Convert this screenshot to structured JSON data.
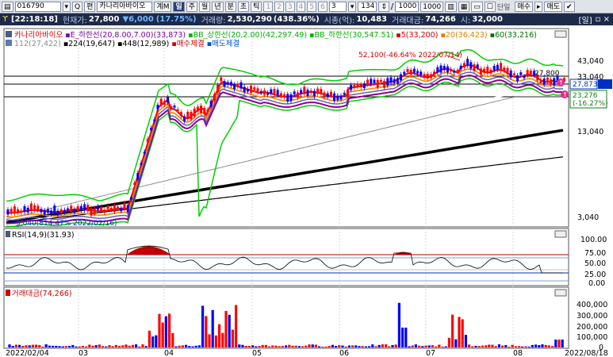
{
  "toolbar": {
    "code": "016790",
    "search_btn": "Q",
    "search_btn2": "편",
    "name": "카나리아바이오",
    "gm_btn": "계M",
    "periods": [
      "일",
      "주",
      "월",
      "년",
      "분",
      "초",
      "틱"
    ],
    "active_period": "일",
    "num_btns": [
      "1",
      "2",
      "3",
      "4",
      "5",
      "6",
      "3"
    ],
    "count": "134",
    "ratio_sep": "/",
    "total": "1000",
    "total_btn": "1000",
    "single_label": "단일",
    "buy_btn": "매수",
    "sell_btn": "매도"
  },
  "infobar": {
    "time": "[22:18:18]",
    "price_label": "현재가:",
    "price": "27,800",
    "change": "▼6,000",
    "change_pct": "(17.75%)",
    "volume_label": "거래량:",
    "volume": "2,530,290",
    "volume_pct": "(438.36%)",
    "mcap_label": "시총(억):",
    "mcap": "10,483",
    "amount_label": "거래대금:",
    "amount": "74,266",
    "open_label": "시:",
    "open": "32,000",
    "right_label": "[일]",
    "win_btns": "▫ ×"
  },
  "legend": {
    "row1": [
      {
        "text": "카나리아바이오",
        "color": "#d00000"
      },
      {
        "text": "E_하한선(20,8.00,7.00)(33,873)",
        "color": "#7a00a0"
      },
      {
        "text": "BB_상한선(20,2.00)(42,297.49)",
        "color": "#00b000"
      },
      {
        "text": "BB_하한선(30,547.51)",
        "color": "#00b000"
      },
      {
        "text": "5(33,200)",
        "color": "#d00000"
      },
      {
        "text": "20(36,423)",
        "color": "#e08000"
      },
      {
        "text": "60(33,216)",
        "color": "#007000"
      }
    ],
    "row2": [
      {
        "text": "112(27,422)",
        "color": "#8c8c8c"
      },
      {
        "text": "224(19,647)",
        "color": "#000000"
      },
      {
        "text": "448(12,989)",
        "color": "#000000"
      },
      {
        "text": "매수체결",
        "color": "#d00000"
      },
      {
        "text": "매도체결",
        "color": "#0050d0"
      }
    ]
  },
  "annotations": {
    "high": "52,100(-46.64% 2022/07/14)",
    "low": "3,040(814.47% 2022/02/16)",
    "current_tag": "27,873",
    "pct_tag_value": "23,276",
    "pct_tag_change": "(-16.27%)",
    "near_price": "27,800"
  },
  "price_axis": [
    "43,040",
    "33,040",
    "13,040",
    "3,040"
  ],
  "rsi": {
    "label": "RSI(14,9)(31.93)",
    "axis": [
      "100.00",
      "75.00",
      "50.00",
      "25.00",
      "0.00"
    ]
  },
  "amount_panel": {
    "label": "거래대금(74,266)",
    "axis": [
      "400,000",
      "300,000",
      "200,000",
      "100,000",
      "0"
    ]
  },
  "date_axis": [
    "2022/02/04",
    "03",
    "04",
    "05",
    "06",
    "07",
    "08",
    "2022/08/18"
  ],
  "colors": {
    "up": "#ff0000",
    "down": "#0000ff",
    "grid": "#cfd3da",
    "ma5": "#ff0000",
    "ma20": "#f29000",
    "bb": "#00cc00",
    "env": "#8b008b"
  }
}
